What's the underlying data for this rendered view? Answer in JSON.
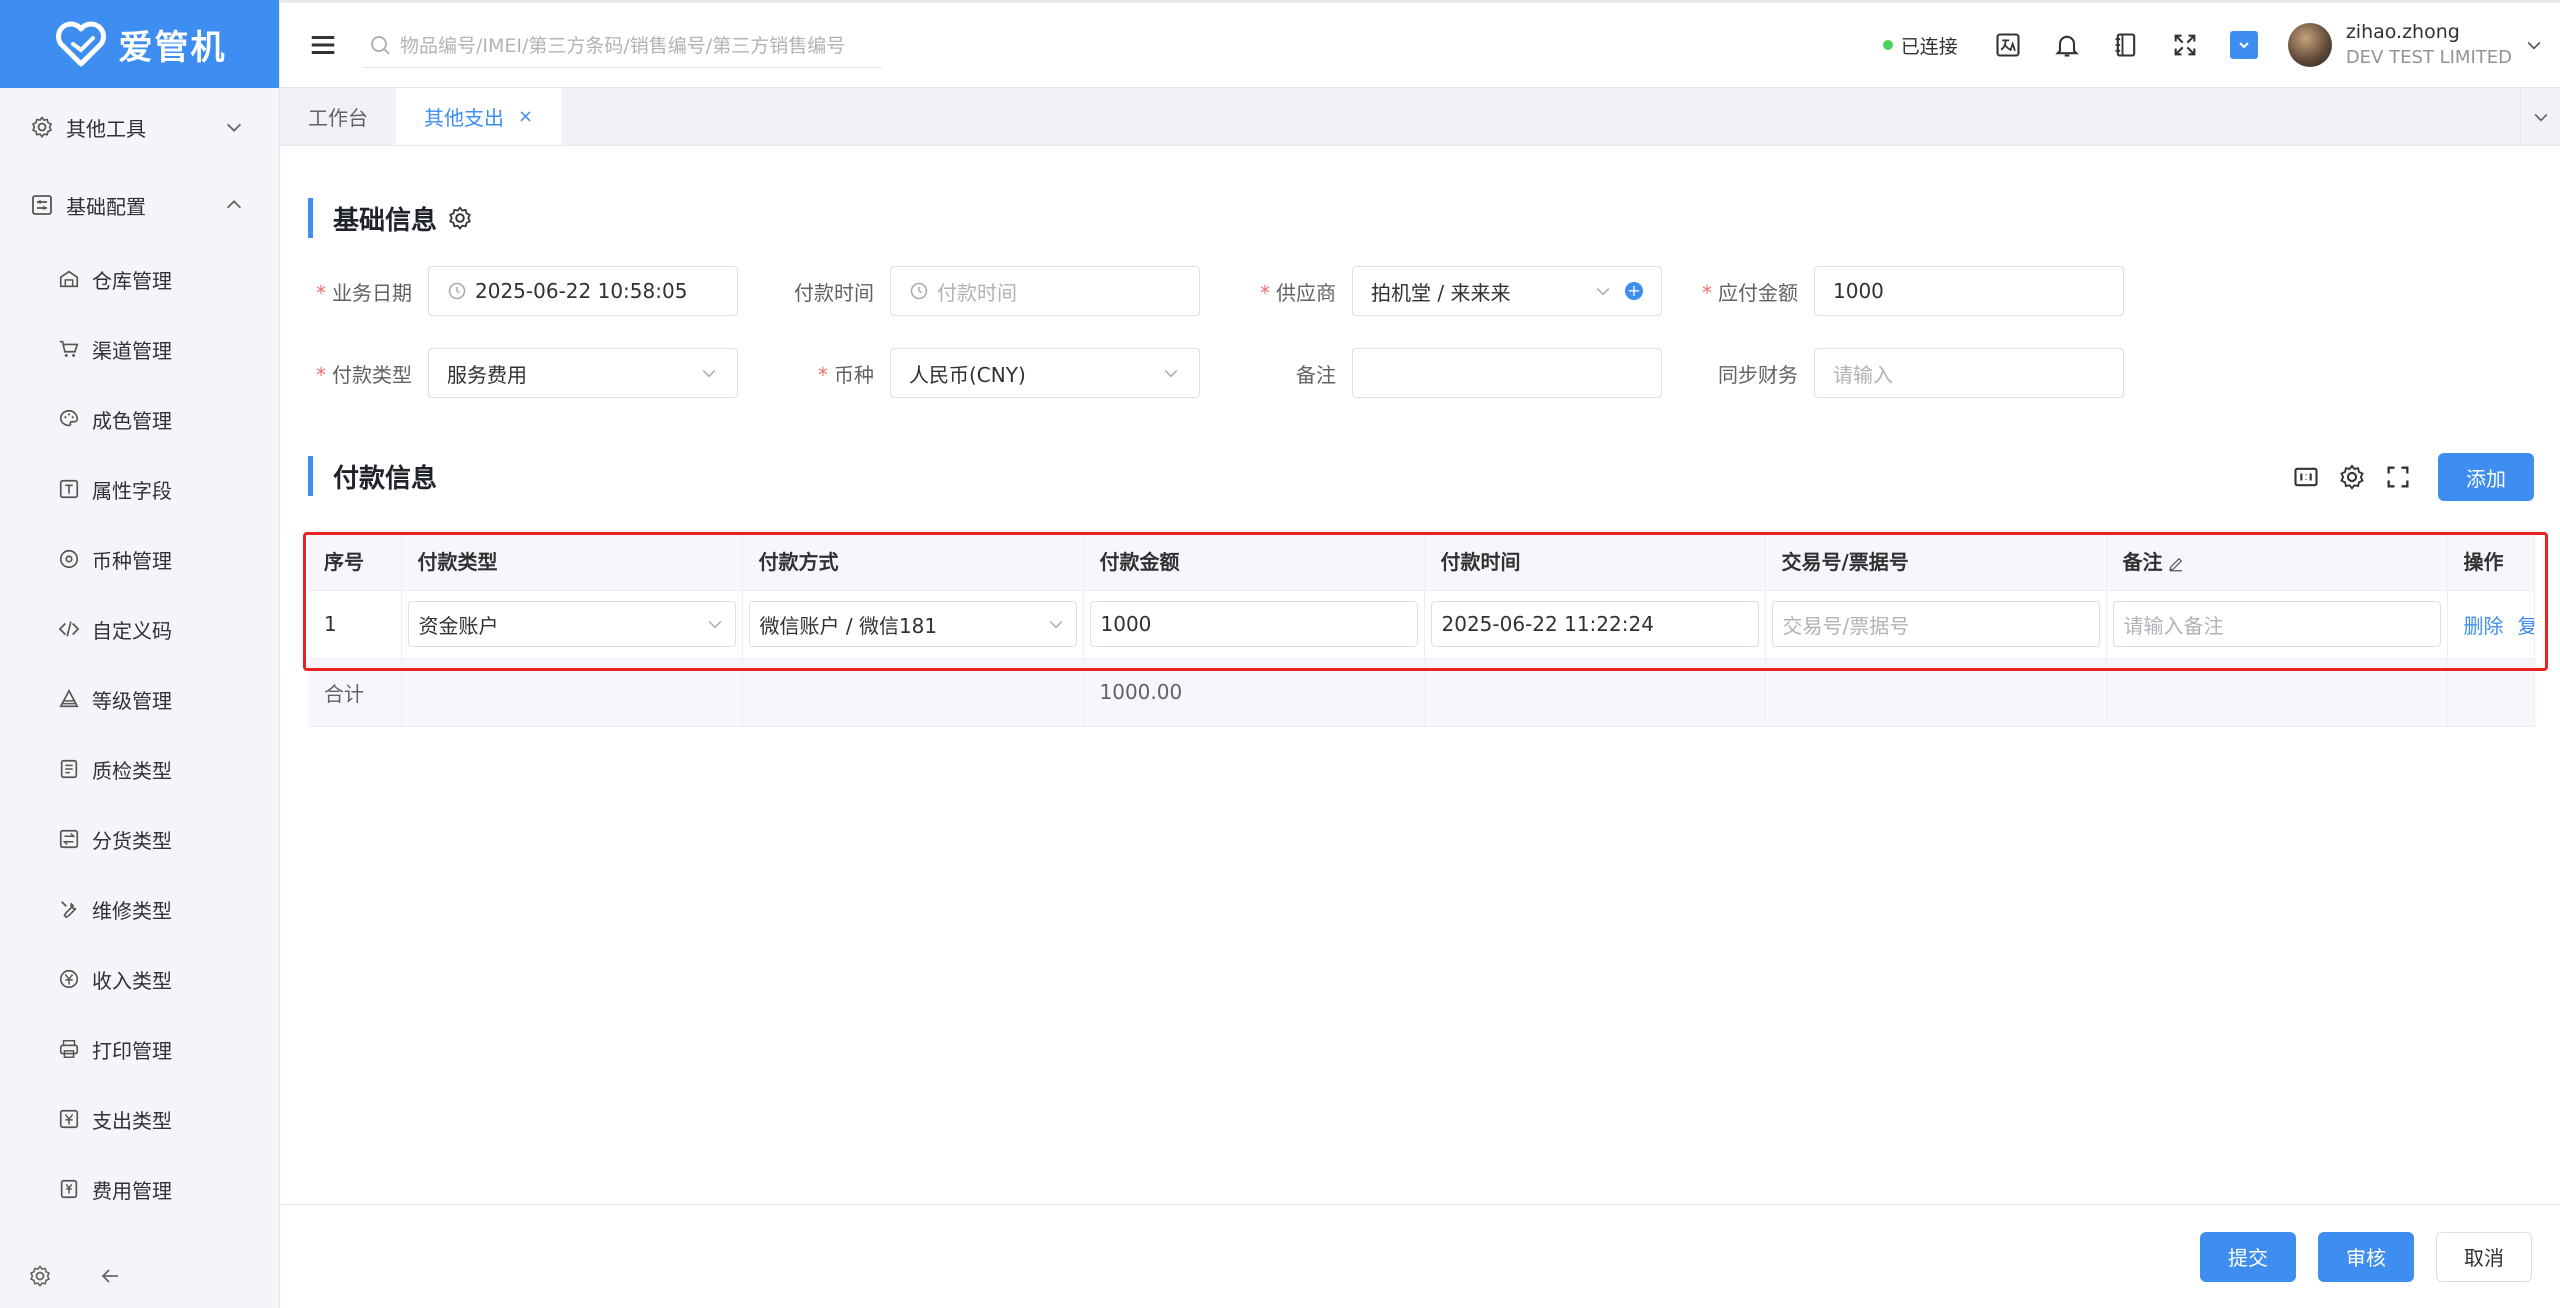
{
  "app": {
    "logo_text": "爱管机"
  },
  "sidebar": {
    "groups": [
      {
        "label": "其他工具",
        "icon": "gear-outline-icon",
        "expanded": false
      },
      {
        "label": "基础配置",
        "icon": "sliders-icon",
        "expanded": true
      }
    ],
    "items": [
      {
        "label": "仓库管理",
        "icon": "warehouse-icon"
      },
      {
        "label": "渠道管理",
        "icon": "cart-icon"
      },
      {
        "label": "成色管理",
        "icon": "palette-icon"
      },
      {
        "label": "属性字段",
        "icon": "text-field-icon"
      },
      {
        "label": "币种管理",
        "icon": "coin-icon"
      },
      {
        "label": "自定义码",
        "icon": "code-icon"
      },
      {
        "label": "等级管理",
        "icon": "level-icon"
      },
      {
        "label": "质检类型",
        "icon": "checklist-icon"
      },
      {
        "label": "分货类型",
        "icon": "transfer-icon"
      },
      {
        "label": "维修类型",
        "icon": "wrench-icon"
      },
      {
        "label": "收入类型",
        "icon": "income-icon"
      },
      {
        "label": "打印管理",
        "icon": "printer-icon"
      },
      {
        "label": "支出类型",
        "icon": "expense-icon"
      },
      {
        "label": "费用管理",
        "icon": "fee-icon"
      }
    ]
  },
  "header": {
    "search_placeholder": "物品编号/IMEI/第三方条码/销售编号/第三方销售编号",
    "connection_status": "已连接",
    "user_name": "zihao.zhong",
    "company": "DEV TEST LIMITED"
  },
  "tabs": [
    {
      "label": "工作台",
      "active": false
    },
    {
      "label": "其他支出",
      "active": true,
      "close": "×"
    }
  ],
  "basic_info": {
    "title": "基础信息",
    "row1": [
      {
        "label": "业务日期",
        "required": true,
        "value": "2025-06-22 10:58:05",
        "placeholder": "",
        "type": "datetime"
      },
      {
        "label": "付款时间",
        "required": false,
        "value": "",
        "placeholder": "付款时间",
        "type": "datetime"
      },
      {
        "label": "供应商",
        "required": true,
        "value": "拍机堂 / 来来来",
        "placeholder": "",
        "type": "select-add"
      },
      {
        "label": "应付金额",
        "required": true,
        "value": "1000",
        "placeholder": "",
        "type": "text"
      }
    ],
    "row2": [
      {
        "label": "付款类型",
        "required": true,
        "value": "服务费用",
        "placeholder": "",
        "type": "select"
      },
      {
        "label": "币种",
        "required": true,
        "value": "人民币(CNY)",
        "placeholder": "",
        "type": "select"
      },
      {
        "label": "备注",
        "required": false,
        "value": "",
        "placeholder": "",
        "type": "text"
      },
      {
        "label": "同步财务",
        "required": false,
        "value": "",
        "placeholder": "请输入",
        "type": "text"
      }
    ]
  },
  "payment_info": {
    "title": "付款信息",
    "add_label": "添加",
    "columns": [
      "序号",
      "付款类型",
      "付款方式",
      "付款金额",
      "付款时间",
      "交易号/票据号",
      "备注",
      "操作"
    ],
    "rows": [
      {
        "index": "1",
        "pay_type": "资金账户",
        "pay_method": "微信账户 / 微信181",
        "amount": "1000",
        "pay_time": "2025-06-22 11:22:24",
        "trade_no_placeholder": "交易号/票据号",
        "remark_placeholder": "请输入备注",
        "op_delete": "删除",
        "op_copy": "复"
      }
    ],
    "summary": {
      "label": "合计",
      "amount": "1000.00"
    }
  },
  "footer": {
    "submit": "提交",
    "audit": "审核",
    "cancel": "取消"
  },
  "colors": {
    "accent": "#3d8ef0",
    "highlight_box": "#e62222",
    "connected": "#4cd35b",
    "required": "#f56c6c"
  }
}
